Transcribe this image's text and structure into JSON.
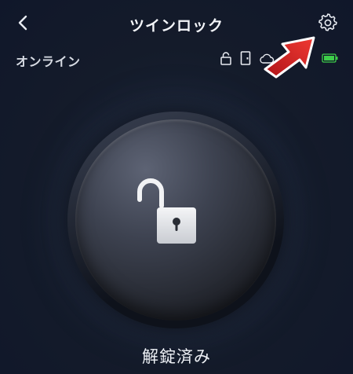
{
  "header": {
    "title": "ツインロック",
    "back_icon": "chevron-left-icon",
    "settings_icon": "gear-icon"
  },
  "status": {
    "text": "オンライン",
    "icons": [
      "lock-open-icon",
      "door-icon",
      "cloud-icon",
      "battery-icon"
    ],
    "battery_color": "#3ecf4a"
  },
  "lock": {
    "state_label": "解錠済み",
    "icon": "unlocked-padlock-icon"
  },
  "annotation": {
    "arrow_color": "#e8262b",
    "target": "settings"
  }
}
